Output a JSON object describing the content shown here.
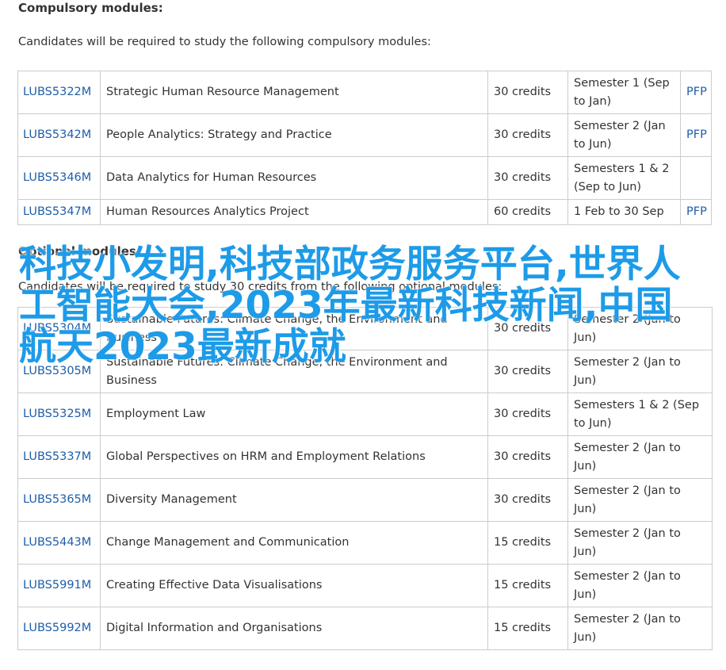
{
  "compulsory": {
    "heading": "Compulsory modules:",
    "intro": "Candidates will be required to study the following compulsory modules:",
    "rows": [
      {
        "code": "LUBS5322M",
        "title": "Strategic Human Resource Management",
        "credits": "30 credits",
        "semester": "Semester 1 (Sep to Jan)",
        "link": "PFP"
      },
      {
        "code": "LUBS5342M",
        "title": "People Analytics: Strategy and Practice",
        "credits": "30 credits",
        "semester": "Semester 2 (Jan to Jun)",
        "link": "PFP"
      },
      {
        "code": "LUBS5346M",
        "title": "Data Analytics for Human Resources",
        "credits": "30 credits",
        "semester": "Semesters 1 & 2 (Sep to Jun)",
        "link": ""
      },
      {
        "code": "LUBS5347M",
        "title": "Human Resources Analytics Project",
        "credits": "60 credits",
        "semester": "1 Feb to 30 Sep",
        "link": "PFP"
      }
    ]
  },
  "optional": {
    "heading": "Optional modules:",
    "intro": "Candidates will be required to study 30 credits from the following optional modules:",
    "rows": [
      {
        "code": "LUBS5304M",
        "title": "Sustainable Futures: Climate Change, the Environment and Business",
        "credits": "30 credits",
        "semester": "Semester 2 (Jan to Jun)"
      },
      {
        "code": "LUBS5305M",
        "title": "Sustainable Futures: Climate Change, the Environment and Business",
        "credits": "30 credits",
        "semester": "Semester 2 (Jan to Jun)"
      },
      {
        "code": "LUBS5325M",
        "title": "Employment Law",
        "credits": "30 credits",
        "semester": "Semesters 1 & 2 (Sep to Jun)"
      },
      {
        "code": "LUBS5337M",
        "title": "Global Perspectives on HRM and Employment Relations",
        "credits": "30 credits",
        "semester": "Semester 2 (Jan to Jun)"
      },
      {
        "code": "LUBS5365M",
        "title": "Diversity Management",
        "credits": "30 credits",
        "semester": "Semester 2 (Jan to Jun)"
      },
      {
        "code": "LUBS5443M",
        "title": "Change Management and Communication",
        "credits": "15 credits",
        "semester": "Semester 2 (Jan to Jun)"
      },
      {
        "code": "LUBS5991M",
        "title": "Creating Effective Data Visualisations",
        "credits": "15 credits",
        "semester": "Semester 2 (Jan to Jun)"
      },
      {
        "code": "LUBS5992M",
        "title": "Digital Information and Organisations",
        "credits": "15 credits",
        "semester": "Semester 2 (Jan to Jun)"
      }
    ]
  },
  "overlay_text": "科技小发明,科技部政务服务平台,世界人工智能大会,2023年最新科技新闻,中国航天2023最新成就",
  "colors": {
    "link": "#1f5ea8",
    "overlay": "#1d9be8",
    "border": "#cccccc",
    "text": "#333333"
  }
}
